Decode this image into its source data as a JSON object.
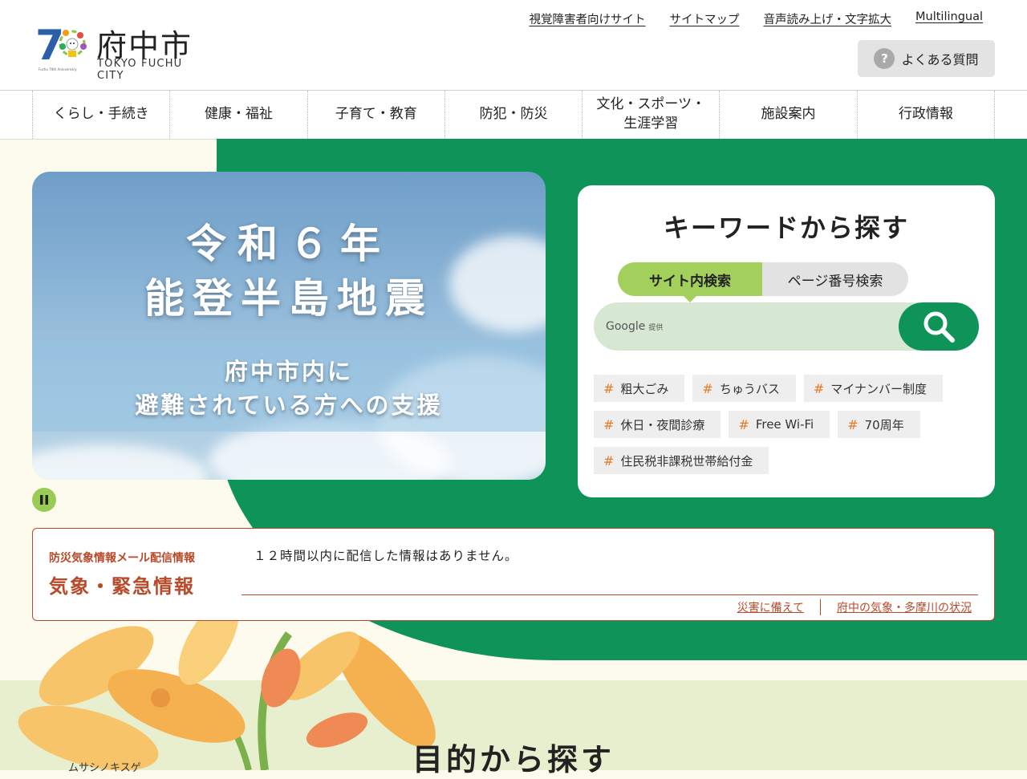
{
  "header": {
    "site_name": "府中市",
    "site_name_en": "TOKYO FUCHU CITY",
    "top_links": [
      "視覚障害者向けサイト",
      "サイトマップ",
      "音声読み上げ・文字拡大",
      "Multilingual"
    ],
    "faq_label": "よくある質問",
    "faq_icon": "question-icon"
  },
  "nav": {
    "items": [
      "くらし・手続き",
      "健康・福祉",
      "子育て・教育",
      "防犯・防災",
      "文化・スポーツ・\n生涯学習",
      "施設案内",
      "行政情報"
    ]
  },
  "banner": {
    "title_line1": "令和６年",
    "title_line2": "能登半島地震",
    "subtitle_line1": "府中市内に",
    "subtitle_line2": "避難されている方への支援",
    "pause_icon": "pause-icon"
  },
  "search": {
    "title": "キーワードから探す",
    "tab_site": "サイト内検索",
    "tab_page": "ページ番号検索",
    "provider": "Google",
    "provider_suffix": "提供",
    "tags": [
      "粗大ごみ",
      "ちゅうバス",
      "マイナンバー制度",
      "休日・夜間診療",
      "Free Wi-Fi",
      "70周年",
      "住民税非課税世帯給付金"
    ]
  },
  "weather": {
    "kicker": "防災気象情報メール配信情報",
    "title": "気象・緊急情報",
    "message": "１２時間以内に配信した情報はありません。",
    "links": [
      "災害に備えて",
      "府中の気象・多摩川の状況"
    ]
  },
  "bottom": {
    "section_title": "目的から探す",
    "flower_caption": "ムサシノキスゲ"
  },
  "colors": {
    "brand_green": "#0e9458",
    "accent_lime": "#a3cf5c",
    "alert_red": "#b84a2a",
    "cream": "#fdfbee"
  }
}
